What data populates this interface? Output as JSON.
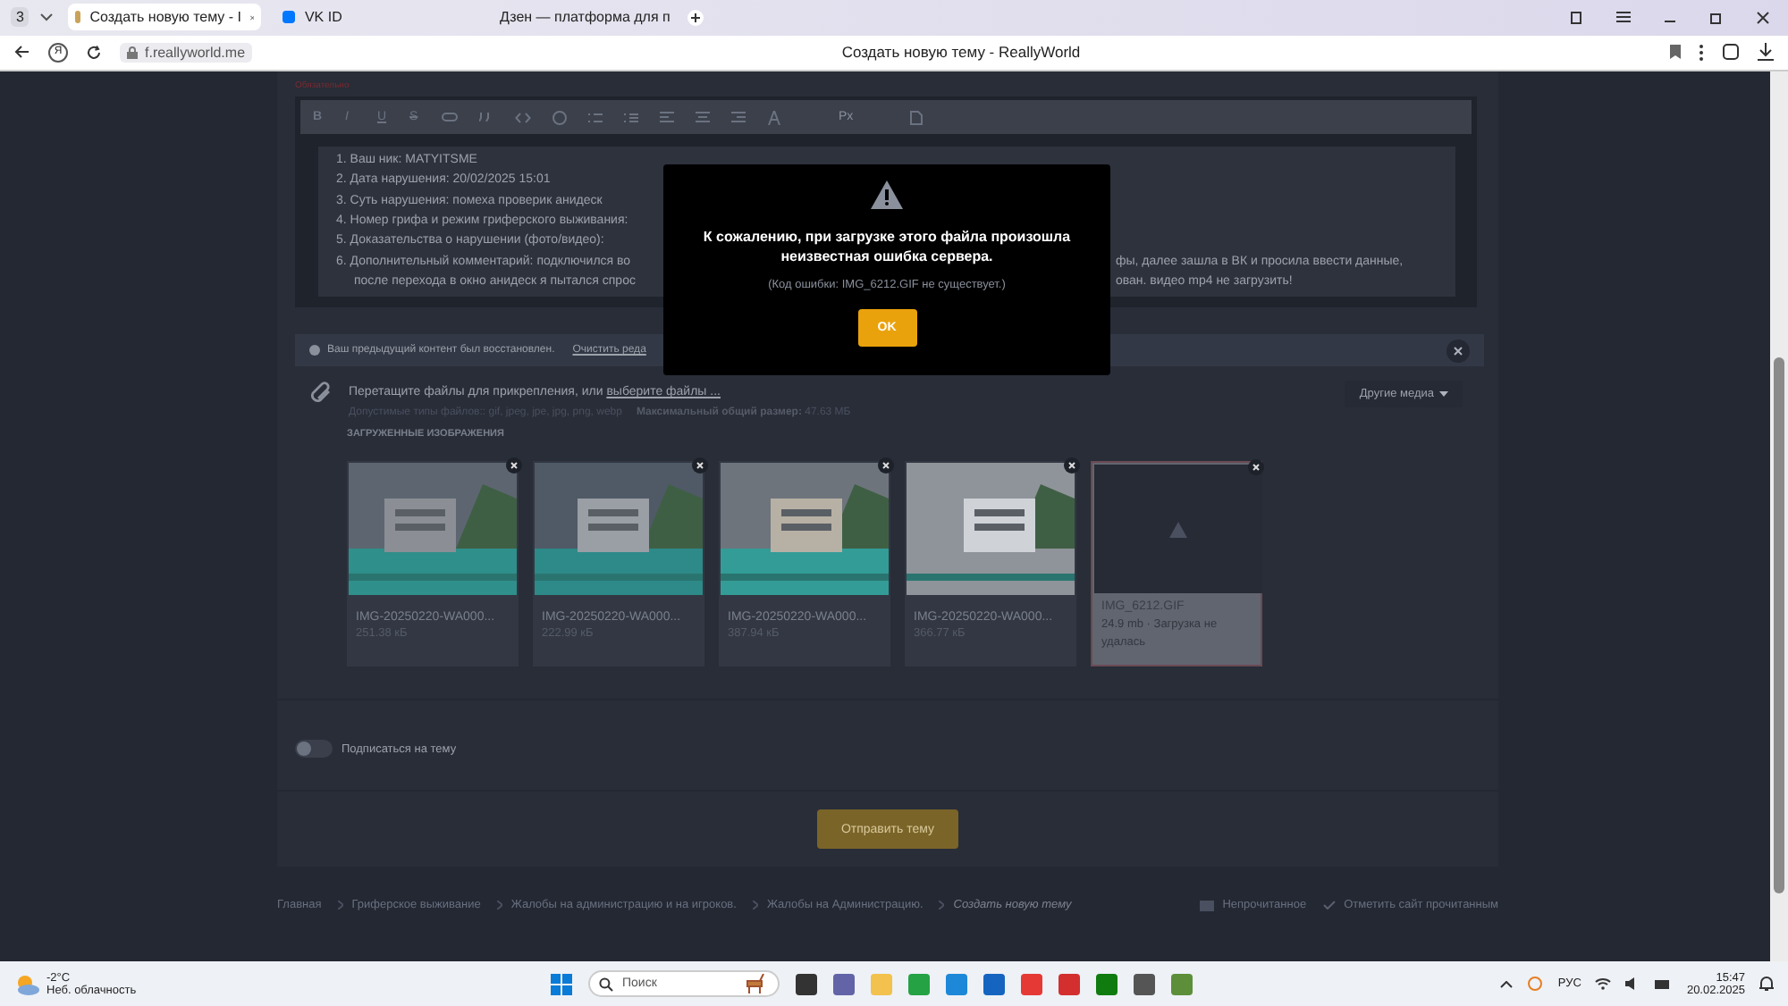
{
  "browser": {
    "tab_count": "3",
    "tabs": [
      {
        "title": "Создать новую тему - I",
        "selected": true
      },
      {
        "title": "VK ID",
        "selected": false
      },
      {
        "title": "Дзен — платформа для п",
        "selected": false
      }
    ],
    "home_button": "Я",
    "address": "f.reallyworld.me",
    "page_title": "Создать новую тему - ReallyWorld"
  },
  "editor": {
    "required_label": "Обязательно",
    "format_buttons": [
      "B",
      "I",
      "U",
      "S"
    ],
    "size_label": "Px",
    "lines": [
      {
        "left": "1. Ваш ник: MATYITSME",
        "continuation": false
      },
      {
        "left": "2. Дата нарушения: 20/02/2025 15:01",
        "continuation": false
      },
      {
        "left": "3. Суть нарушения: помеха проверик анидеск",
        "continuation": false
      },
      {
        "left": "4. Номер грифа и режим гриферского выживания:",
        "continuation": false
      },
      {
        "left": "5. Доказательства о нарушении (фото/видео):",
        "continuation": false
      },
      {
        "left": "6. Дополнительный комментарий: подключился во",
        "right": "фы, далее зашла в ВК и просила ввести данные,",
        "continuation": false
      },
      {
        "left": "после перехода в окно анидеск я пытался спрос",
        "right": "ован. видео mp4 не загрузить!",
        "continuation": true
      }
    ]
  },
  "restored_notice": {
    "text": "Ваш предыдущий контент был восстановлен.",
    "link": "Очистить реда"
  },
  "upload": {
    "prompt": "Перетащите файлы для прикрепления, или ",
    "prompt_link": "выберите файлы ...",
    "other_media": "Другие медиа",
    "allowed_types": "Допустимые типы файлов:: gif, jpeg, jpe, jpg, png, webp",
    "max_size": "**Максимальный общий размер:** 47.63 МБ",
    "heading": "ЗАГРУЖЕННЫЕ ИЗОБРАЖЕНИЯ",
    "files": [
      {
        "name": "IMG-20250220-WA000...",
        "size": "251.38 кБ"
      },
      {
        "name": "IMG-20250220-WA000...",
        "size": "222.99 кБ"
      },
      {
        "name": "IMG-20250220-WA000...",
        "size": "387.94 кБ"
      },
      {
        "name": "IMG-20250220-WA000...",
        "size": "366.77 кБ"
      },
      {
        "kind": "failed",
        "name": "IMG_6212.GIF",
        "size": "24.9 mb · Загрузка не удалась"
      }
    ]
  },
  "subscribe": {
    "label": "Подписаться на тему",
    "on": false
  },
  "submit": "Отправить тему",
  "breadcrumbs": [
    {
      "label": "Главная",
      "selected": false
    },
    {
      "label": "Гриферское выживание",
      "selected": false
    },
    {
      "label": "Жалобы на администрацию и на игроков.",
      "selected": false
    },
    {
      "label": "Жалобы на Администрацию.",
      "selected": false
    },
    {
      "label": "Создать новую тему",
      "selected": true
    }
  ],
  "footer_links": [
    "Непрочитанное",
    "Отметить сайт прочитанным"
  ],
  "modal": {
    "title": "К сожалению, при загрузке этого файла произошла неизвестная ошибка сервера.",
    "detail": "(Код ошибки: IMG_6212.GIF не существует.)",
    "button": "OK"
  },
  "taskbar": {
    "temperature": "-2°C",
    "weather": "Неб. облачность",
    "search_placeholder": "Поиск",
    "language": "РУС",
    "time": "15:47",
    "date": "20.02.2025"
  }
}
